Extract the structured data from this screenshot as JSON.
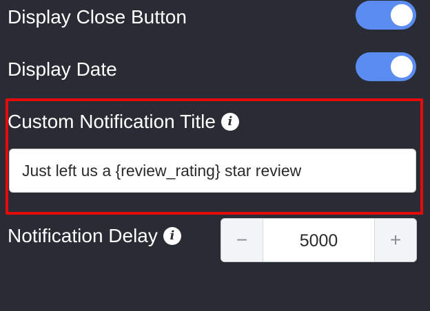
{
  "settings": {
    "close_button": {
      "label": "Display Close Button",
      "enabled": true
    },
    "display_date": {
      "label": "Display Date",
      "enabled": true
    },
    "notification_title": {
      "label": "Custom Notification Title",
      "value": "Just left us a {review_rating} star review",
      "info_glyph": "i"
    },
    "notification_delay": {
      "label": "Notification Delay",
      "value": "5000",
      "info_glyph": "i",
      "decrement_glyph": "−",
      "increment_glyph": "+"
    }
  },
  "icons": {
    "info": "info-icon",
    "decrement": "minus-icon",
    "increment": "plus-icon"
  },
  "colors": {
    "background": "#292c35",
    "toggle_on": "#5b8cf1",
    "highlight_border": "#e50b0b",
    "text": "#ffffff"
  }
}
